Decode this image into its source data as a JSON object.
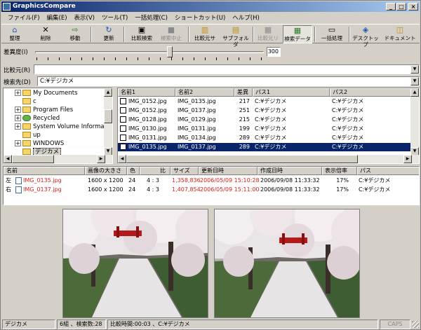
{
  "app": {
    "title": "GraphicsCompare"
  },
  "window_buttons": {
    "minimize": "_",
    "maximize": "□",
    "close": "×"
  },
  "menu": [
    "ファイル(F)",
    "編集(E)",
    "表示(V)",
    "ツール(T)",
    "一括処理(C)",
    "ショートカット(U)",
    "ヘルプ(H)"
  ],
  "toolbar": {
    "buttons": [
      {
        "label": "整理",
        "icon": "⌂"
      },
      {
        "label": "削除",
        "icon": "✕"
      },
      {
        "label": "移動",
        "icon": "⇨"
      },
      {
        "label": "更新",
        "icon": "↻"
      },
      {
        "label": "比較検索",
        "icon": "▣"
      },
      {
        "label": "検索中止",
        "icon": "■"
      },
      {
        "label": "比較元サ",
        "icon": "▥"
      },
      {
        "label": "サブフォルダ",
        "icon": "▤"
      },
      {
        "label": "比較元リ",
        "icon": "▦"
      },
      {
        "label": "検索データ",
        "icon": "▦"
      },
      {
        "label": "一括処理",
        "icon": "▭"
      },
      {
        "label": "デスクトップ",
        "icon": "◈"
      },
      {
        "label": "ドキュメント",
        "icon": "◫"
      }
    ]
  },
  "similarity": {
    "label": "差異度(I)",
    "value": "300",
    "level_percent": 59
  },
  "compare_source": {
    "label": "比較元(R)",
    "value": ""
  },
  "search_target": {
    "label": "検索先(D)",
    "value": "C:¥デジカメ"
  },
  "tree": {
    "items": [
      {
        "label": "My Documents",
        "expander": "+"
      },
      {
        "label": "c",
        "expander": ""
      },
      {
        "label": "Program Files",
        "expander": "+"
      },
      {
        "label": "Recycled",
        "expander": "+"
      },
      {
        "label": "System Volume Informati",
        "expander": "+"
      },
      {
        "label": "up",
        "expander": ""
      },
      {
        "label": "WINDOWS",
        "expander": "+"
      },
      {
        "label": "デジカメ",
        "expander": "",
        "selected": true
      }
    ]
  },
  "results": {
    "columns": [
      "名前1",
      "名前2",
      "差異",
      "パス1",
      "パス2"
    ],
    "rows": [
      {
        "name1": "IMG_0152.jpg",
        "name2": "IMG_0135.jpg",
        "diff": "217",
        "path1": "C:¥デジカメ",
        "path2": "C:¥デジカメ"
      },
      {
        "name1": "IMG_0152.jpg",
        "name2": "IMG_0137.jpg",
        "diff": "251",
        "path1": "C:¥デジカメ",
        "path2": "C:¥デジカメ"
      },
      {
        "name1": "IMG_0128.jpg",
        "name2": "IMG_0129.jpg",
        "diff": "215",
        "path1": "C:¥デジカメ",
        "path2": "C:¥デジカメ"
      },
      {
        "name1": "IMG_0130.jpg",
        "name2": "IMG_0131.jpg",
        "diff": "199",
        "path1": "C:¥デジカメ",
        "path2": "C:¥デジカメ"
      },
      {
        "name1": "IMG_0131.jpg",
        "name2": "IMG_0134.jpg",
        "diff": "289",
        "path1": "C:¥デジカメ",
        "path2": "C:¥デジカメ"
      },
      {
        "name1": "IMG_0135.jpg",
        "name2": "IMG_0137.jpg",
        "diff": "289",
        "path1": "C:¥デジカメ",
        "path2": "C:¥デジカメ",
        "selected": true
      }
    ]
  },
  "details": {
    "columns": [
      "名前",
      "画像の大きさ",
      "色",
      "比",
      "サイズ",
      "更新日時",
      "作成日時",
      "表示倍率",
      "パス"
    ],
    "rows": [
      {
        "side": "左",
        "name": "IMG_0135.jpg",
        "dims": "1600 x 1200",
        "color": "24",
        "ratio": "4 : 3",
        "size": "1,358,836",
        "modified": "2006/05/09 15:10:28",
        "created": "2006/09/08 11:33:32",
        "zoom": "17%",
        "path": "C:¥デジカメ"
      },
      {
        "side": "右",
        "name": "IMG_0137.jpg",
        "dims": "1600 x 1200",
        "color": "24",
        "ratio": "4 : 3",
        "size": "1,407,854",
        "modified": "2006/05/09 15:11:00",
        "created": "2006/09/08 11:33:32",
        "zoom": "17%",
        "path": "C:¥デジカメ"
      }
    ]
  },
  "status": {
    "folder": "デジカメ",
    "counts": "6組 、検索数:28",
    "time": "比較時間:00:03 、C:¥デジカメ",
    "caps": "CAPS"
  },
  "colors": {
    "title_start": "#0a246a",
    "title_end": "#a6caf0",
    "selection": "#0a246a",
    "highlight_text": "#e0201a",
    "chrome": "#d4d0c8"
  }
}
